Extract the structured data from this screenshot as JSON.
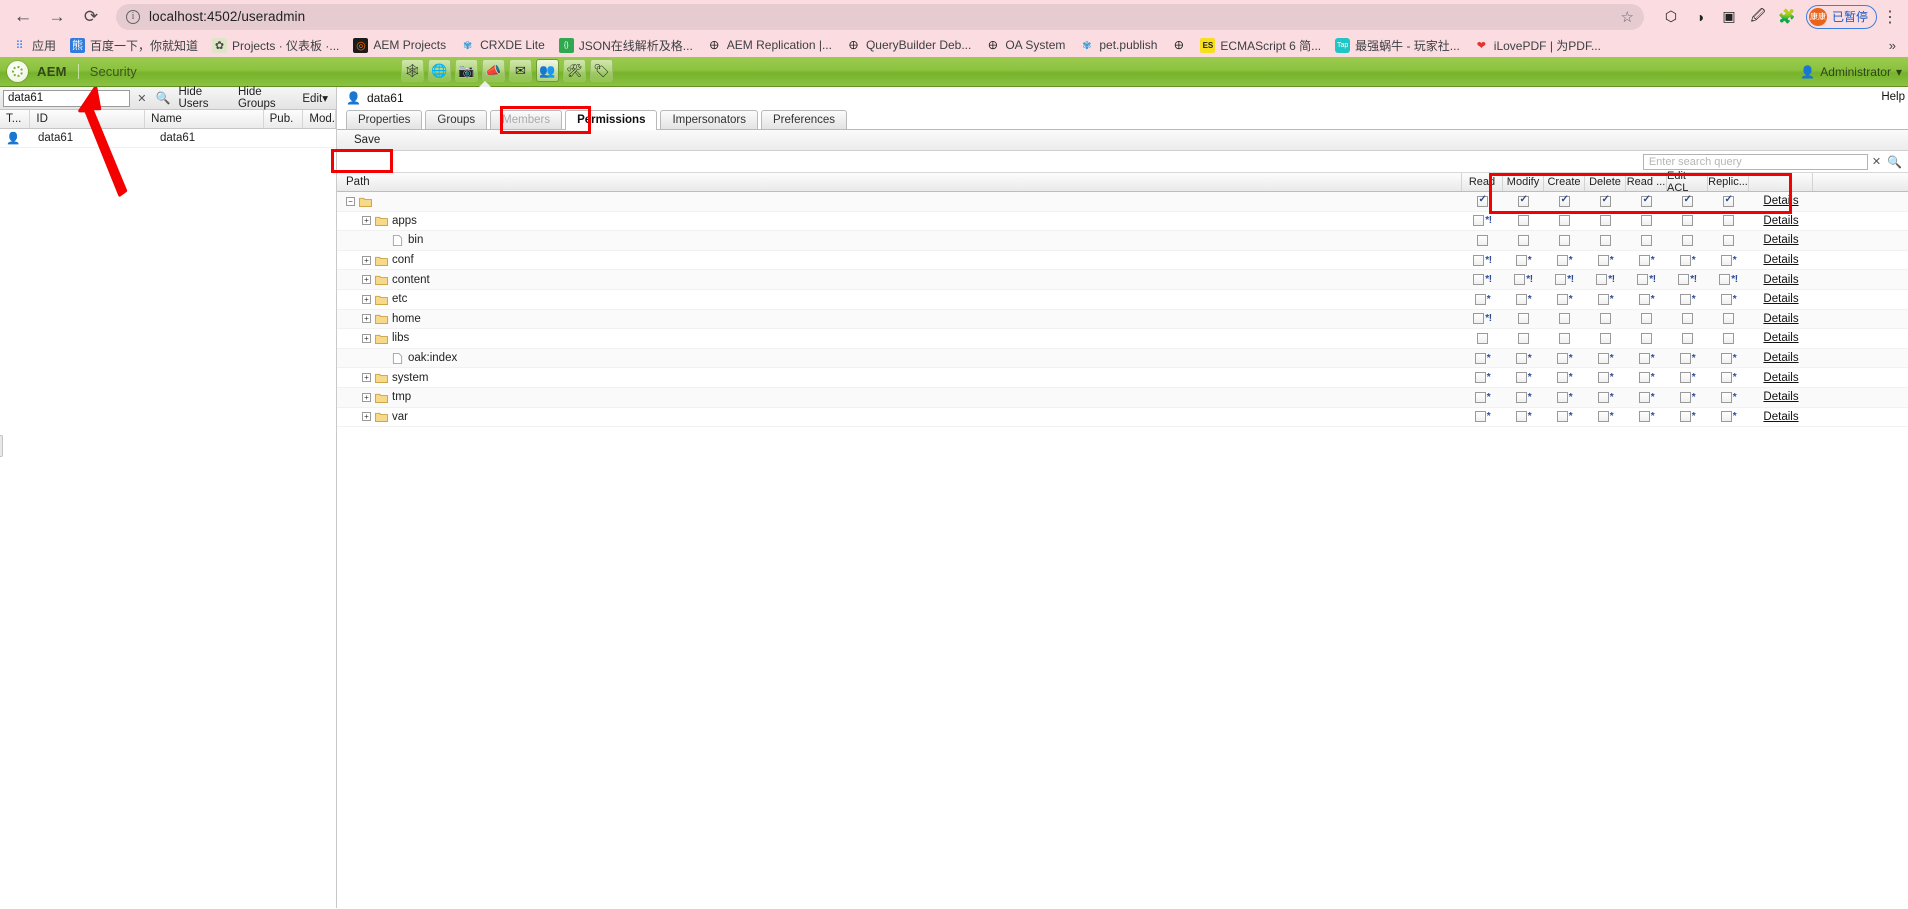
{
  "browser": {
    "nav": {
      "back": "←",
      "forward": "→",
      "reload": "⟳"
    },
    "url": "localhost:4502/useradmin",
    "info_icon": "i",
    "star_icon": "☆",
    "right_icons": [
      "circle-icon",
      "moon-icon",
      "cast-icon",
      "extension-blue-icon",
      "puzzle-icon"
    ],
    "profile": {
      "initials": "康康",
      "status": "已暂停"
    },
    "menu_icon": "⋮",
    "bookmarks": [
      {
        "label": "应用",
        "icon": "apps-grid-icon",
        "glyph": "⠿",
        "color": "#4285f4",
        "bg": "transparent"
      },
      {
        "label": "百度一下，你就知道",
        "icon": "baidu-icon",
        "glyph": "熊",
        "color": "#ffffff",
        "bg": "#2e7ce0"
      },
      {
        "label": "Projects · 仪表板 ·...",
        "icon": "gitlab-icon",
        "glyph": "✿",
        "color": "#4a4a4a",
        "bg": "#dfe6c8"
      },
      {
        "label": "AEM Projects",
        "icon": "aem-icon",
        "glyph": "◎",
        "color": "#ff6a00",
        "bg": "#1b1b1b"
      },
      {
        "label": "CRXDE Lite",
        "icon": "crxde-icon",
        "glyph": "✾",
        "color": "#2d9cdb",
        "bg": "transparent"
      },
      {
        "label": "JSON在线解析及格...",
        "icon": "json-icon",
        "glyph": "{}",
        "color": "#ffffff",
        "bg": "#2fa84f"
      },
      {
        "label": "AEM Replication |...",
        "icon": "globe-dark-icon",
        "glyph": "🜨",
        "color": "#1b1b1b",
        "bg": "transparent"
      },
      {
        "label": "QueryBuilder Deb...",
        "icon": "globe-dark-icon",
        "glyph": "🜨",
        "color": "#1b1b1b",
        "bg": "transparent"
      },
      {
        "label": "OA System",
        "icon": "globe-dark-icon",
        "glyph": "🜨",
        "color": "#1b1b1b",
        "bg": "transparent"
      },
      {
        "label": "pet.publish",
        "icon": "crxde-icon",
        "glyph": "✾",
        "color": "#2d9cdb",
        "bg": "transparent"
      },
      {
        "label": "",
        "icon": "globe-dark-icon",
        "glyph": "🜨",
        "color": "#1b1b1b",
        "bg": "transparent"
      },
      {
        "label": "ECMAScript 6 简...",
        "icon": "es-icon",
        "glyph": "ES",
        "color": "#1b1b1b",
        "bg": "#f7df1e"
      },
      {
        "label": "最强蜗牛 - 玩家社...",
        "icon": "taptap-icon",
        "glyph": "Tap",
        "color": "#ffffff",
        "bg": "#1ec6c6"
      },
      {
        "label": "iLovePDF | 为PDF...",
        "icon": "heart-icon",
        "glyph": "❤",
        "color": "#e5322d",
        "bg": "transparent"
      }
    ],
    "overflow_icon": "»"
  },
  "aem_header": {
    "logo_name": "aem-logo",
    "title": "AEM",
    "subtitle": "Security",
    "tools": [
      {
        "name": "siteadmin-icon",
        "glyph": "🕸"
      },
      {
        "name": "websites-icon",
        "glyph": "🌐"
      },
      {
        "name": "dam-icon",
        "glyph": "📷"
      },
      {
        "name": "campaigns-icon",
        "glyph": "📣"
      },
      {
        "name": "inbox-icon",
        "glyph": "✉"
      },
      {
        "name": "users-icon",
        "glyph": "👥",
        "selected": true
      },
      {
        "name": "tools-icon",
        "glyph": "🛠"
      },
      {
        "name": "tagging-icon",
        "glyph": "🏷"
      }
    ],
    "admin": {
      "label": "Administrator",
      "caret": "▾",
      "avatar": "👤"
    }
  },
  "left_panel": {
    "search": {
      "value": "data61",
      "clear": "✕",
      "magnifier": "🔍"
    },
    "hide_users": "Hide Users",
    "hide_groups": "Hide Groups",
    "edit": "Edit",
    "edit_caret": "▾",
    "columns": [
      "T...",
      "ID",
      "Name",
      "Pub.",
      "Mod."
    ],
    "rows": [
      {
        "type_icon": "user-icon",
        "id": "data61",
        "name": "data61",
        "pub": "",
        "mod": ""
      }
    ]
  },
  "right_panel": {
    "breadcrumb": {
      "icon": "user-icon",
      "label": "data61"
    },
    "tabs": [
      {
        "label": "Properties",
        "state": "normal"
      },
      {
        "label": "Groups",
        "state": "normal"
      },
      {
        "label": "Members",
        "state": "disabled"
      },
      {
        "label": "Permissions",
        "state": "active"
      },
      {
        "label": "Impersonators",
        "state": "normal"
      },
      {
        "label": "Preferences",
        "state": "normal"
      }
    ],
    "save_label": "Save",
    "help_label": "Help",
    "query": {
      "placeholder": "Enter search query",
      "value": "",
      "clear": "✕",
      "magnifier": "🔍"
    },
    "grid": {
      "path_header": "Path",
      "permission_headers": [
        "Read",
        "Modify",
        "Create",
        "Delete",
        "Read ...",
        "Edit ACL",
        "Replic..."
      ],
      "details_label": "Details",
      "rows": [
        {
          "label": "",
          "indent": 0,
          "expander": "−",
          "icon": "folder-open-icon",
          "checks": [
            true,
            true,
            true,
            true,
            true,
            true,
            true
          ],
          "marks": [
            "",
            "",
            "",
            "",
            "",
            "",
            ""
          ]
        },
        {
          "label": "apps",
          "indent": 1,
          "expander": "+",
          "icon": "folder-icon",
          "checks": [
            false,
            false,
            false,
            false,
            false,
            false,
            false
          ],
          "marks": [
            "*!",
            "",
            "",
            "",
            "",
            "",
            ""
          ]
        },
        {
          "label": "bin",
          "indent": 2,
          "expander": "",
          "icon": "file-icon",
          "checks": [
            false,
            false,
            false,
            false,
            false,
            false,
            false
          ],
          "marks": [
            "",
            "",
            "",
            "",
            "",
            "",
            ""
          ]
        },
        {
          "label": "conf",
          "indent": 1,
          "expander": "+",
          "icon": "folder-icon",
          "checks": [
            false,
            false,
            false,
            false,
            false,
            false,
            false
          ],
          "marks": [
            "*!",
            "*",
            "*",
            "*",
            "*",
            "*",
            "*"
          ]
        },
        {
          "label": "content",
          "indent": 1,
          "expander": "+",
          "icon": "folder-icon",
          "checks": [
            false,
            false,
            false,
            false,
            false,
            false,
            false
          ],
          "marks": [
            "*!",
            "*!",
            "*!",
            "*!",
            "*!",
            "*!",
            "*!"
          ]
        },
        {
          "label": "etc",
          "indent": 1,
          "expander": "+",
          "icon": "folder-icon",
          "checks": [
            false,
            false,
            false,
            false,
            false,
            false,
            false
          ],
          "marks": [
            "*",
            "*",
            "*",
            "*",
            "*",
            "*",
            "*"
          ]
        },
        {
          "label": "home",
          "indent": 1,
          "expander": "+",
          "icon": "folder-icon",
          "checks": [
            false,
            false,
            false,
            false,
            false,
            false,
            false
          ],
          "marks": [
            "*!",
            "",
            "",
            "",
            "",
            "",
            ""
          ]
        },
        {
          "label": "libs",
          "indent": 1,
          "expander": "+",
          "icon": "folder-icon",
          "checks": [
            false,
            false,
            false,
            false,
            false,
            false,
            false
          ],
          "marks": [
            "",
            "",
            "",
            "",
            "",
            "",
            ""
          ]
        },
        {
          "label": "oak:index",
          "indent": 2,
          "expander": "",
          "icon": "file-icon",
          "checks": [
            false,
            false,
            false,
            false,
            false,
            false,
            false
          ],
          "marks": [
            "*",
            "*",
            "*",
            "*",
            "*",
            "*",
            "*"
          ]
        },
        {
          "label": "system",
          "indent": 1,
          "expander": "+",
          "icon": "folder-icon",
          "checks": [
            false,
            false,
            false,
            false,
            false,
            false,
            false
          ],
          "marks": [
            "*",
            "*",
            "*",
            "*",
            "*",
            "*",
            "*"
          ]
        },
        {
          "label": "tmp",
          "indent": 1,
          "expander": "+",
          "icon": "folder-icon",
          "checks": [
            false,
            false,
            false,
            false,
            false,
            false,
            false
          ],
          "marks": [
            "*",
            "*",
            "*",
            "*",
            "*",
            "*",
            "*"
          ]
        },
        {
          "label": "var",
          "indent": 1,
          "expander": "+",
          "icon": "folder-icon",
          "checks": [
            false,
            false,
            false,
            false,
            false,
            false,
            false
          ],
          "marks": [
            "*",
            "*",
            "*",
            "*",
            "*",
            "*",
            "*"
          ]
        }
      ]
    }
  },
  "annotations": {
    "highlight_color": "#f40000",
    "boxes": [
      "permissions-tab-box",
      "save-button-box",
      "permission-columns-box"
    ],
    "arrow": "search-field-arrow"
  }
}
